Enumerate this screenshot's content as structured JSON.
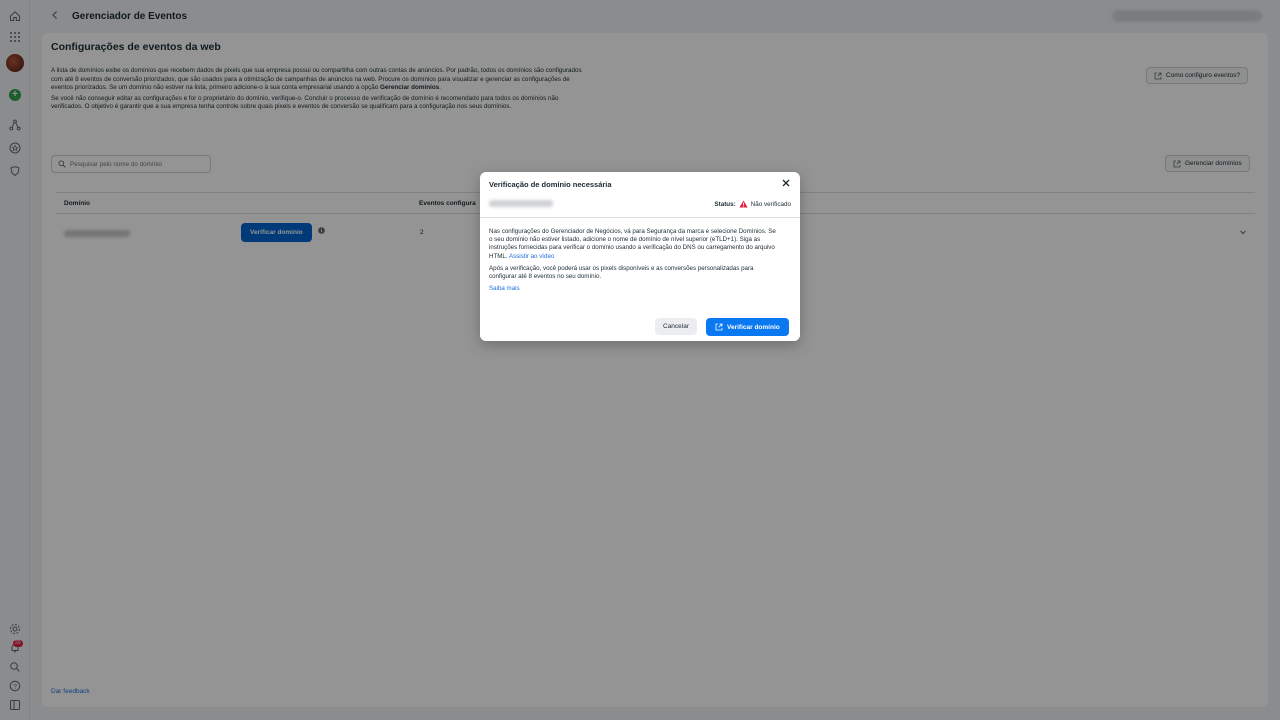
{
  "app": {
    "title": "Gerenciador de Eventos"
  },
  "page": {
    "title": "Configurações de eventos da web",
    "description_1": "A lista de domínios exibe os domínios que recebem dados de pixels que sua empresa possui ou compartilha com outras contas de anúncios. Por padrão, todos os domínios são configurados com até 8 eventos de conversão priorizados, que são usados para a otimização de campanhas de anúncios na web. Procure os domínios para visualizar e gerenciar as configurações de eventos priorizados. Se um domínio não estiver na lista, primeiro adicione-o à sua conta empresarial usando a opção",
    "description_1_bold": "Gerenciar domínios",
    "description_2": "Se você não conseguir editar as configurações e for o proprietário do domínio, verifique-o. Concluir o processo de verificação de domínio é recomendado para todos os domínios não verificados. O objetivo é garantir que a sua empresa tenha controle sobre quais pixels e eventos de conversão se qualificam para a configuração nos seus domínios.",
    "help_button": "Como configuro eventos?",
    "manage_button": "Gerenciar domínios",
    "search_placeholder": "Pesquisar pelo nome do domínio",
    "table": {
      "col_domain": "Domínio",
      "col_events": "Eventos configura",
      "row": {
        "verify_button": "Verificar domínio",
        "events_count": "2"
      }
    },
    "feedback": "Dar feedback"
  },
  "rail": {
    "notif_count": "20"
  },
  "modal": {
    "title": "Verificação de domínio necessária",
    "status_label": "Status:",
    "status_value": "Não verificado",
    "para_1": "Nas configurações do Gerenciador de Negócios, vá para Segurança da marca e selecione Domínios. Se o seu domínio não estiver listado, adicione o nome de domínio de nível superior (eTLD+1). Siga as instruções fornecidas para verificar o domínio usando a verificação do DNS ou carregamento do arquivo HTML.",
    "para_1_link": "Assistir ao vídeo",
    "para_2": "Após a verificação, você poderá usar os pixels disponíveis e as conversões personalizadas para configurar até 8 eventos no seu domínio.",
    "learn_more": "Saiba mais",
    "cancel": "Cancelar",
    "verify": "Verificar domínio"
  },
  "colors": {
    "primary": "#0064d1",
    "link": "#216fdb",
    "warning": "#e41e3f"
  }
}
